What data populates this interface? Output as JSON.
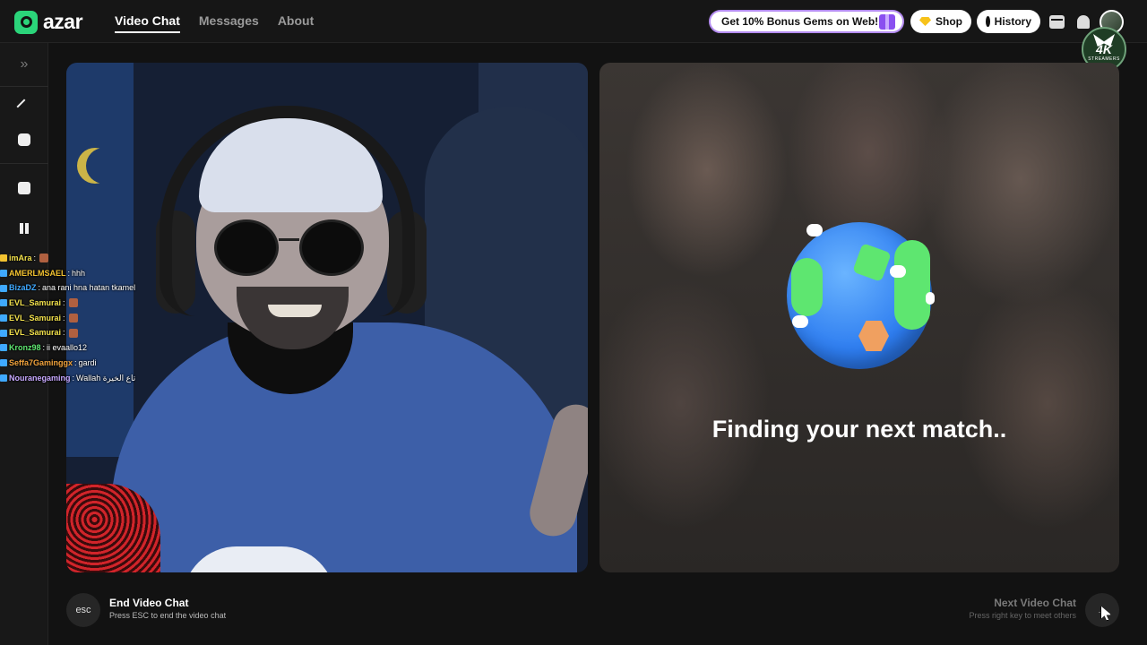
{
  "header": {
    "logo_text": "azar",
    "nav": [
      {
        "label": "Video Chat",
        "active": true
      },
      {
        "label": "Messages",
        "active": false
      },
      {
        "label": "About",
        "active": false
      }
    ],
    "promo_text": "Get 10% Bonus Gems on Web!",
    "shop_label": "Shop",
    "history_label": "History",
    "icons": [
      "gift-icon",
      "gem-icon",
      "clock-icon",
      "store-icon",
      "bell-icon",
      "avatar"
    ]
  },
  "badge": {
    "title": "4K",
    "subtitle": "STREAMERS"
  },
  "sidebar": {
    "icons": [
      "expand-icon",
      "magic-wand-icon",
      "sticker-icon",
      "dice-icon",
      "pause-icon"
    ]
  },
  "chat_overlay": [
    {
      "user": "imAra",
      "text": "",
      "user_color": "#f2e14c",
      "emote": true
    },
    {
      "user": "AMERLMSAEL",
      "text": "hhh",
      "user_color": "#f2c230",
      "emote": false
    },
    {
      "user": "BizaDZ",
      "text": "ana rani hna hatan tkamel",
      "user_color": "#3fa9ff",
      "emote": false
    },
    {
      "user": "EVL_Samurai",
      "text": "",
      "user_color": "#f2e14c",
      "emote": true
    },
    {
      "user": "EVL_Samurai",
      "text": "",
      "user_color": "#f2e14c",
      "emote": true
    },
    {
      "user": "EVL_Samurai",
      "text": "",
      "user_color": "#f2e14c",
      "emote": true
    },
    {
      "user": "Kronz98",
      "text": "ii evaallo12",
      "user_color": "#5ee670",
      "emote": false
    },
    {
      "user": "Seffa7Gaminggx",
      "text": "gardi",
      "user_color": "#f2a33c",
      "emote": false
    },
    {
      "user": "Nouranegaming",
      "text": "Wallah تاع الخيرة",
      "user_color": "#c7a8ff",
      "emote": false
    }
  ],
  "match_panel": {
    "status_text": "Finding your next match.."
  },
  "footer": {
    "end_key": "esc",
    "end_title": "End Video Chat",
    "end_sub": "Press ESC to end the video chat",
    "next_title": "Next Video Chat",
    "next_sub": "Press right key to meet others",
    "next_icon": "arrow-right-icon"
  },
  "colors": {
    "brand": "#2bd47a",
    "background": "#121212",
    "promo_border": "#b48cf0"
  }
}
